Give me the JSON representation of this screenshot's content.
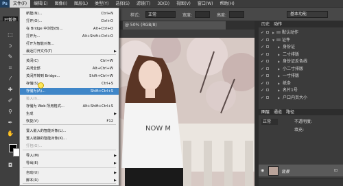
{
  "app": {
    "logo": "Ps",
    "overlay_label": "已暂停"
  },
  "menubar": {
    "items": [
      "文件(F)",
      "编辑(E)",
      "图像(I)",
      "图层(L)",
      "类型(Y)",
      "选择(S)",
      "滤镜(T)",
      "3D(D)",
      "视图(V)",
      "窗口(W)",
      "帮助(H)"
    ],
    "active": "文件(F)"
  },
  "options": {
    "style_label": "样式:",
    "style_value": "正常",
    "width_label": "宽度:",
    "height_label": "高度:",
    "workspace": "基本功能"
  },
  "document": {
    "tab_label": "@ 50% (RGB/8)"
  },
  "file_menu": {
    "items": [
      {
        "label": "新建(N)...",
        "shortcut": "Ctrl+N"
      },
      {
        "label": "打开(O)...",
        "shortcut": "Ctrl+O"
      },
      {
        "label": "在 Bridge 中浏览(B)...",
        "shortcut": "Alt+Ctrl+O"
      },
      {
        "label": "打开为...",
        "shortcut": "Alt+Shift+Ctrl+O"
      },
      {
        "label": "打开为智能对象...",
        "shortcut": ""
      },
      {
        "label": "最近打开文件(T)",
        "shortcut": "",
        "submenu": true
      },
      {
        "label": "关闭(C)",
        "shortcut": "Ctrl+W"
      },
      {
        "label": "关闭全部",
        "shortcut": "Alt+Ctrl+W"
      },
      {
        "label": "关闭并转到 Bridge...",
        "shortcut": "Shift+Ctrl+W"
      },
      {
        "label": "存储(S)",
        "shortcut": "Ctrl+S"
      },
      {
        "label": "存储为(A)...",
        "shortcut": "Shift+Ctrl+S",
        "highlighted": true
      },
      {
        "label": "签入(I)...",
        "shortcut": "",
        "dim": true
      },
      {
        "label": "存储为 Web 所用格式...",
        "shortcut": "Alt+Shift+Ctrl+S"
      },
      {
        "label": "生成",
        "shortcut": "",
        "submenu": true
      },
      {
        "label": "恢复(V)",
        "shortcut": "F12"
      },
      {
        "label": "置入嵌入的智能对象(L)...",
        "shortcut": ""
      },
      {
        "label": "置入链接的智能对象(K)...",
        "shortcut": ""
      },
      {
        "label": "打包(G)...",
        "shortcut": "",
        "dim": true
      },
      {
        "label": "导入(M)",
        "shortcut": "",
        "submenu": true
      },
      {
        "label": "导出(E)",
        "shortcut": "",
        "submenu": true
      },
      {
        "label": "自动(U)",
        "shortcut": "",
        "submenu": true
      },
      {
        "label": "脚本(R)",
        "shortcut": "",
        "submenu": true
      },
      {
        "label": "文件简介(F)...",
        "shortcut": "Alt+Shift+Ctrl+I"
      }
    ]
  },
  "actions_panel": {
    "tabs": [
      "历史",
      "动作"
    ],
    "items": [
      {
        "label": "默认动作",
        "kind": "set"
      },
      {
        "label": "证件",
        "kind": "set"
      },
      {
        "label": "身份证",
        "kind": "action"
      },
      {
        "label": "二寸排版",
        "kind": "action"
      },
      {
        "label": "身份证反色线",
        "kind": "action"
      },
      {
        "label": "小二寸排版",
        "kind": "action"
      },
      {
        "label": "一寸排版",
        "kind": "action"
      },
      {
        "label": "纸条",
        "kind": "action"
      },
      {
        "label": "名片1号",
        "kind": "action"
      },
      {
        "label": "户口内页大小",
        "kind": "action"
      }
    ]
  },
  "layers_panel": {
    "tabs": [
      "图层",
      "通道",
      "路径"
    ],
    "blend_mode": "正常",
    "opacity_label": "不透明度:",
    "fill_label": "填充:",
    "layer_name": "背景"
  }
}
